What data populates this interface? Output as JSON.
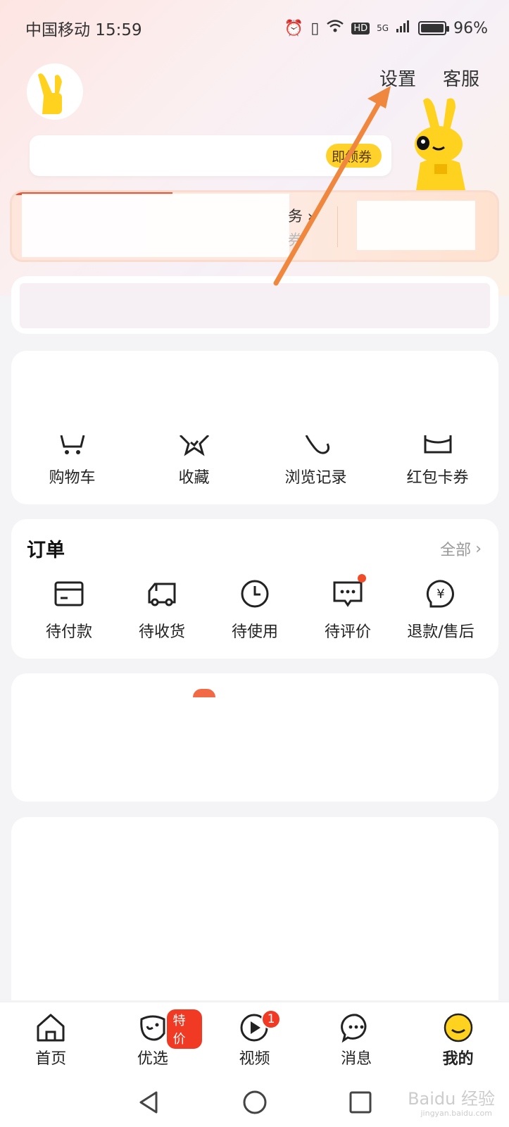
{
  "status_bar": {
    "carrier_time": "中国移动 15:59",
    "network": "HD",
    "signal": "5G",
    "battery": "96%"
  },
  "header": {
    "settings": "设置",
    "service": "客服"
  },
  "coupon": {
    "chip": "即领券"
  },
  "vip": {
    "line1": "务",
    "line2": "券"
  },
  "tools": [
    {
      "label": "购物车",
      "icon": "cart-icon"
    },
    {
      "label": "收藏",
      "icon": "star-icon"
    },
    {
      "label": "浏览记录",
      "icon": "history-icon"
    },
    {
      "label": "红包卡券",
      "icon": "coupon-icon"
    }
  ],
  "orders": {
    "title": "订单",
    "all": "全部",
    "items": [
      {
        "label": "待付款",
        "icon": "wallet-icon"
      },
      {
        "label": "待收货",
        "icon": "truck-icon"
      },
      {
        "label": "待使用",
        "icon": "clock-icon"
      },
      {
        "label": "待评价",
        "icon": "comment-icon",
        "dot": true
      },
      {
        "label": "退款/售后",
        "icon": "refund-icon"
      }
    ]
  },
  "tabbar": {
    "items": [
      {
        "label": "首页",
        "icon": "home-icon"
      },
      {
        "label": "优选",
        "icon": "select-icon",
        "badge": "特价"
      },
      {
        "label": "视频",
        "icon": "video-icon",
        "badge": "1"
      },
      {
        "label": "消息",
        "icon": "message-icon"
      },
      {
        "label": "我的",
        "icon": "mine-icon",
        "active": true
      }
    ]
  },
  "watermark": {
    "brand": "Baidu 经验",
    "url": "jingyan.baidu.com"
  },
  "colors": {
    "accent_orange": "#f0873e",
    "badge_red": "#f03a23",
    "coupon_yellow": "#ffd12b",
    "mascot_yellow": "#ffd21f"
  }
}
